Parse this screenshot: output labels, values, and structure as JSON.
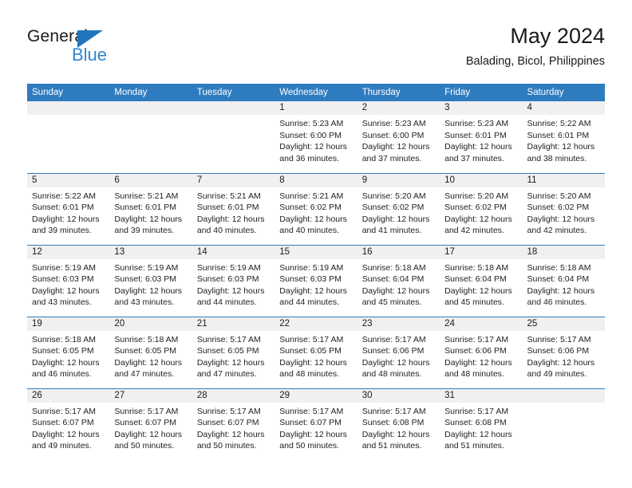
{
  "brand": {
    "name_part1": "General",
    "name_part2": "Blue",
    "triangle_icon": "triangle-icon",
    "color_dark": "#1a1a1a",
    "color_blue": "#2f86cf"
  },
  "header": {
    "title": "May 2024",
    "subtitle": "Balading, Bicol, Philippines"
  },
  "theme": {
    "header_bg": "#2f7bbf",
    "header_text": "#ffffff",
    "daynum_band_bg": "#f0f0f0",
    "row_divider": "#2f7bbf",
    "cell_bg": "#ffffff"
  },
  "weekday_headers": [
    "Sunday",
    "Monday",
    "Tuesday",
    "Wednesday",
    "Thursday",
    "Friday",
    "Saturday"
  ],
  "weeks": [
    [
      {
        "day": "",
        "sunrise": "",
        "sunset": "",
        "daylight_line1": "",
        "daylight_line2": "",
        "empty": true
      },
      {
        "day": "",
        "sunrise": "",
        "sunset": "",
        "daylight_line1": "",
        "daylight_line2": "",
        "empty": true
      },
      {
        "day": "",
        "sunrise": "",
        "sunset": "",
        "daylight_line1": "",
        "daylight_line2": "",
        "empty": true
      },
      {
        "day": "1",
        "sunrise": "Sunrise: 5:23 AM",
        "sunset": "Sunset: 6:00 PM",
        "daylight_line1": "Daylight: 12 hours",
        "daylight_line2": "and 36 minutes."
      },
      {
        "day": "2",
        "sunrise": "Sunrise: 5:23 AM",
        "sunset": "Sunset: 6:00 PM",
        "daylight_line1": "Daylight: 12 hours",
        "daylight_line2": "and 37 minutes."
      },
      {
        "day": "3",
        "sunrise": "Sunrise: 5:23 AM",
        "sunset": "Sunset: 6:01 PM",
        "daylight_line1": "Daylight: 12 hours",
        "daylight_line2": "and 37 minutes."
      },
      {
        "day": "4",
        "sunrise": "Sunrise: 5:22 AM",
        "sunset": "Sunset: 6:01 PM",
        "daylight_line1": "Daylight: 12 hours",
        "daylight_line2": "and 38 minutes."
      }
    ],
    [
      {
        "day": "5",
        "sunrise": "Sunrise: 5:22 AM",
        "sunset": "Sunset: 6:01 PM",
        "daylight_line1": "Daylight: 12 hours",
        "daylight_line2": "and 39 minutes."
      },
      {
        "day": "6",
        "sunrise": "Sunrise: 5:21 AM",
        "sunset": "Sunset: 6:01 PM",
        "daylight_line1": "Daylight: 12 hours",
        "daylight_line2": "and 39 minutes."
      },
      {
        "day": "7",
        "sunrise": "Sunrise: 5:21 AM",
        "sunset": "Sunset: 6:01 PM",
        "daylight_line1": "Daylight: 12 hours",
        "daylight_line2": "and 40 minutes."
      },
      {
        "day": "8",
        "sunrise": "Sunrise: 5:21 AM",
        "sunset": "Sunset: 6:02 PM",
        "daylight_line1": "Daylight: 12 hours",
        "daylight_line2": "and 40 minutes."
      },
      {
        "day": "9",
        "sunrise": "Sunrise: 5:20 AM",
        "sunset": "Sunset: 6:02 PM",
        "daylight_line1": "Daylight: 12 hours",
        "daylight_line2": "and 41 minutes."
      },
      {
        "day": "10",
        "sunrise": "Sunrise: 5:20 AM",
        "sunset": "Sunset: 6:02 PM",
        "daylight_line1": "Daylight: 12 hours",
        "daylight_line2": "and 42 minutes."
      },
      {
        "day": "11",
        "sunrise": "Sunrise: 5:20 AM",
        "sunset": "Sunset: 6:02 PM",
        "daylight_line1": "Daylight: 12 hours",
        "daylight_line2": "and 42 minutes."
      }
    ],
    [
      {
        "day": "12",
        "sunrise": "Sunrise: 5:19 AM",
        "sunset": "Sunset: 6:03 PM",
        "daylight_line1": "Daylight: 12 hours",
        "daylight_line2": "and 43 minutes."
      },
      {
        "day": "13",
        "sunrise": "Sunrise: 5:19 AM",
        "sunset": "Sunset: 6:03 PM",
        "daylight_line1": "Daylight: 12 hours",
        "daylight_line2": "and 43 minutes."
      },
      {
        "day": "14",
        "sunrise": "Sunrise: 5:19 AM",
        "sunset": "Sunset: 6:03 PM",
        "daylight_line1": "Daylight: 12 hours",
        "daylight_line2": "and 44 minutes."
      },
      {
        "day": "15",
        "sunrise": "Sunrise: 5:19 AM",
        "sunset": "Sunset: 6:03 PM",
        "daylight_line1": "Daylight: 12 hours",
        "daylight_line2": "and 44 minutes."
      },
      {
        "day": "16",
        "sunrise": "Sunrise: 5:18 AM",
        "sunset": "Sunset: 6:04 PM",
        "daylight_line1": "Daylight: 12 hours",
        "daylight_line2": "and 45 minutes."
      },
      {
        "day": "17",
        "sunrise": "Sunrise: 5:18 AM",
        "sunset": "Sunset: 6:04 PM",
        "daylight_line1": "Daylight: 12 hours",
        "daylight_line2": "and 45 minutes."
      },
      {
        "day": "18",
        "sunrise": "Sunrise: 5:18 AM",
        "sunset": "Sunset: 6:04 PM",
        "daylight_line1": "Daylight: 12 hours",
        "daylight_line2": "and 46 minutes."
      }
    ],
    [
      {
        "day": "19",
        "sunrise": "Sunrise: 5:18 AM",
        "sunset": "Sunset: 6:05 PM",
        "daylight_line1": "Daylight: 12 hours",
        "daylight_line2": "and 46 minutes."
      },
      {
        "day": "20",
        "sunrise": "Sunrise: 5:18 AM",
        "sunset": "Sunset: 6:05 PM",
        "daylight_line1": "Daylight: 12 hours",
        "daylight_line2": "and 47 minutes."
      },
      {
        "day": "21",
        "sunrise": "Sunrise: 5:17 AM",
        "sunset": "Sunset: 6:05 PM",
        "daylight_line1": "Daylight: 12 hours",
        "daylight_line2": "and 47 minutes."
      },
      {
        "day": "22",
        "sunrise": "Sunrise: 5:17 AM",
        "sunset": "Sunset: 6:05 PM",
        "daylight_line1": "Daylight: 12 hours",
        "daylight_line2": "and 48 minutes."
      },
      {
        "day": "23",
        "sunrise": "Sunrise: 5:17 AM",
        "sunset": "Sunset: 6:06 PM",
        "daylight_line1": "Daylight: 12 hours",
        "daylight_line2": "and 48 minutes."
      },
      {
        "day": "24",
        "sunrise": "Sunrise: 5:17 AM",
        "sunset": "Sunset: 6:06 PM",
        "daylight_line1": "Daylight: 12 hours",
        "daylight_line2": "and 48 minutes."
      },
      {
        "day": "25",
        "sunrise": "Sunrise: 5:17 AM",
        "sunset": "Sunset: 6:06 PM",
        "daylight_line1": "Daylight: 12 hours",
        "daylight_line2": "and 49 minutes."
      }
    ],
    [
      {
        "day": "26",
        "sunrise": "Sunrise: 5:17 AM",
        "sunset": "Sunset: 6:07 PM",
        "daylight_line1": "Daylight: 12 hours",
        "daylight_line2": "and 49 minutes."
      },
      {
        "day": "27",
        "sunrise": "Sunrise: 5:17 AM",
        "sunset": "Sunset: 6:07 PM",
        "daylight_line1": "Daylight: 12 hours",
        "daylight_line2": "and 50 minutes."
      },
      {
        "day": "28",
        "sunrise": "Sunrise: 5:17 AM",
        "sunset": "Sunset: 6:07 PM",
        "daylight_line1": "Daylight: 12 hours",
        "daylight_line2": "and 50 minutes."
      },
      {
        "day": "29",
        "sunrise": "Sunrise: 5:17 AM",
        "sunset": "Sunset: 6:07 PM",
        "daylight_line1": "Daylight: 12 hours",
        "daylight_line2": "and 50 minutes."
      },
      {
        "day": "30",
        "sunrise": "Sunrise: 5:17 AM",
        "sunset": "Sunset: 6:08 PM",
        "daylight_line1": "Daylight: 12 hours",
        "daylight_line2": "and 51 minutes."
      },
      {
        "day": "31",
        "sunrise": "Sunrise: 5:17 AM",
        "sunset": "Sunset: 6:08 PM",
        "daylight_line1": "Daylight: 12 hours",
        "daylight_line2": "and 51 minutes."
      },
      {
        "day": "",
        "sunrise": "",
        "sunset": "",
        "daylight_line1": "",
        "daylight_line2": "",
        "empty": true
      }
    ]
  ]
}
